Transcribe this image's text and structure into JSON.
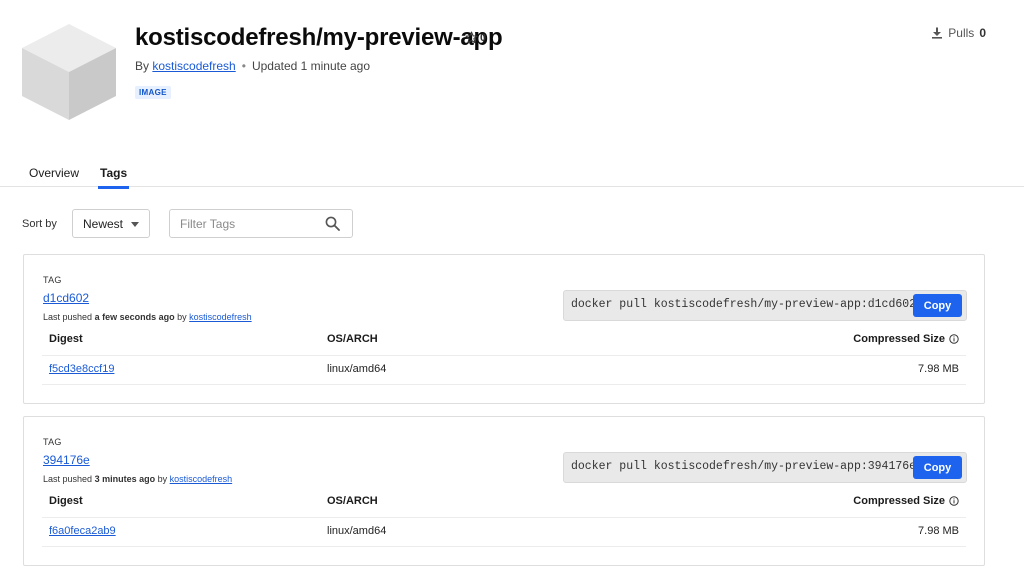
{
  "repo": {
    "title": "kostiscodefresh/my-preview-app",
    "star_count": "0",
    "by_prefix": "By",
    "owner": "kostiscodefresh",
    "updated": "Updated 1 minute ago",
    "badge": "IMAGE",
    "pulls_label": "Pulls",
    "pulls_count": "0"
  },
  "tabs": [
    {
      "label": "Overview",
      "active": false
    },
    {
      "label": "Tags",
      "active": true
    }
  ],
  "controls": {
    "sort_label": "Sort by",
    "sort_value": "Newest",
    "filter_placeholder": "Filter Tags"
  },
  "table_headers": {
    "digest": "Digest",
    "os_arch": "OS/ARCH",
    "compressed_size": "Compressed Size"
  },
  "tags": [
    {
      "label": "TAG",
      "name": "d1cd602",
      "pushed_prefix": "Last pushed",
      "pushed_when": "a few seconds ago",
      "pushed_by_prefix": "by",
      "pushed_by": "kostiscodefresh",
      "pull_command": "docker pull kostiscodefresh/my-preview-app:d1cd602",
      "copy_label": "Copy",
      "digest": "f5cd3e8ccf19",
      "os_arch": "linux/amd64",
      "size": "7.98 MB"
    },
    {
      "label": "TAG",
      "name": "394176e",
      "pushed_prefix": "Last pushed",
      "pushed_when": "3 minutes ago",
      "pushed_by_prefix": "by",
      "pushed_by": "kostiscodefresh",
      "pull_command": "docker pull kostiscodefresh/my-preview-app:394176e",
      "copy_label": "Copy",
      "digest": "f6a0feca2ab9",
      "os_arch": "linux/amd64",
      "size": "7.98 MB"
    }
  ],
  "colors": {
    "accent": "#1d63ed",
    "link": "#1a5ad7"
  }
}
